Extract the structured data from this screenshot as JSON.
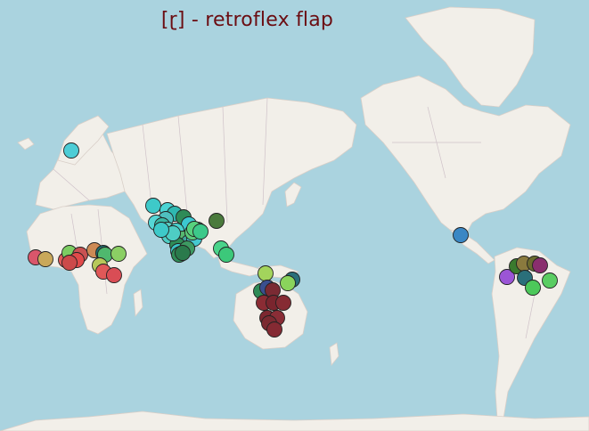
{
  "map": {
    "title": "[ɽ] - retroflex flap",
    "land_color": "#f2efe9",
    "water_color": "#aad3df",
    "marker_stroke": "#222222",
    "markers": [
      {
        "region": "scandinavia",
        "color": "#4ecdd6"
      },
      {
        "region": "west-africa",
        "color": "#d9566b"
      },
      {
        "region": "west-africa",
        "color": "#c9a85a"
      },
      {
        "region": "west-africa",
        "color": "#e05a5a"
      },
      {
        "region": "west-africa",
        "color": "#d94848"
      },
      {
        "region": "west-africa",
        "color": "#7ccc62"
      },
      {
        "region": "west-africa",
        "color": "#c95252"
      },
      {
        "region": "west-africa",
        "color": "#e04a4a"
      },
      {
        "region": "west-africa",
        "color": "#cc4a4a"
      },
      {
        "region": "west-africa",
        "color": "#cd8a55"
      },
      {
        "region": "west-africa",
        "color": "#1f6e6e"
      },
      {
        "region": "west-africa",
        "color": "#4fb86e"
      },
      {
        "region": "west-africa",
        "color": "#b8c85a"
      },
      {
        "region": "west-africa",
        "color": "#e05858"
      },
      {
        "region": "west-africa",
        "color": "#d94d55"
      },
      {
        "region": "west-africa",
        "color": "#8bcf64"
      },
      {
        "region": "south-asia",
        "color": "#3ec9c9"
      },
      {
        "region": "south-asia",
        "color": "#4ad4d4"
      },
      {
        "region": "south-asia",
        "color": "#2fb8b0"
      },
      {
        "region": "south-asia",
        "color": "#4fbfbf"
      },
      {
        "region": "south-asia",
        "color": "#55d6d6"
      },
      {
        "region": "south-asia",
        "color": "#3bb7a3"
      },
      {
        "region": "south-asia",
        "color": "#5bd3c7"
      },
      {
        "region": "south-asia",
        "color": "#2e8b57"
      },
      {
        "region": "south-asia",
        "color": "#3cc8d0"
      },
      {
        "region": "south-asia",
        "color": "#48d1cc"
      },
      {
        "region": "south-asia",
        "color": "#35a36a"
      },
      {
        "region": "south-asia",
        "color": "#4ecdc4"
      },
      {
        "region": "south-asia",
        "color": "#56b870"
      },
      {
        "region": "south-asia",
        "color": "#3fa9a0"
      },
      {
        "region": "south-asia",
        "color": "#2e8b57"
      },
      {
        "region": "south-asia",
        "color": "#3bc4c4"
      },
      {
        "region": "south-asia",
        "color": "#55d0a0"
      },
      {
        "region": "south-asia",
        "color": "#47b883"
      },
      {
        "region": "south-asia",
        "color": "#2e7d4f"
      },
      {
        "region": "south-asia",
        "color": "#45c8d0"
      },
      {
        "region": "south-asia",
        "color": "#3d9a62"
      },
      {
        "region": "south-asia",
        "color": "#5cc97a"
      },
      {
        "region": "south-asia",
        "color": "#2e8b57"
      },
      {
        "region": "south-asia",
        "color": "#2a7a4c"
      },
      {
        "region": "south-asia",
        "color": "#4ecdc4"
      },
      {
        "region": "south-asia",
        "color": "#3ec9c9"
      },
      {
        "region": "south-asia",
        "color": "#4a7a3c"
      },
      {
        "region": "south-asia",
        "color": "#57d17d"
      },
      {
        "region": "south-asia",
        "color": "#3dc98a"
      },
      {
        "region": "southeast-asia",
        "color": "#4ad38a"
      },
      {
        "region": "southeast-asia",
        "color": "#3cc87a"
      },
      {
        "region": "australia-new-guinea",
        "color": "#a3d45c"
      },
      {
        "region": "australia-new-guinea",
        "color": "#2a6f7a"
      },
      {
        "region": "australia-new-guinea",
        "color": "#8ad45c"
      },
      {
        "region": "australia-new-guinea",
        "color": "#2e8b57"
      },
      {
        "region": "australia-new-guinea",
        "color": "#3a4f8f"
      },
      {
        "region": "australia-new-guinea",
        "color": "#7a2a33"
      },
      {
        "region": "australia-new-guinea",
        "color": "#8b2c34"
      },
      {
        "region": "australia-new-guinea",
        "color": "#7a252e"
      },
      {
        "region": "australia-new-guinea",
        "color": "#862b33"
      },
      {
        "region": "australia-new-guinea",
        "color": "#7d2730"
      },
      {
        "region": "australia-new-guinea",
        "color": "#8a2d36"
      },
      {
        "region": "australia-new-guinea",
        "color": "#7b2a31"
      },
      {
        "region": "australia-new-guinea",
        "color": "#852a33"
      },
      {
        "region": "mexico",
        "color": "#3a87c4"
      },
      {
        "region": "south-america",
        "color": "#9b55d6"
      },
      {
        "region": "south-america",
        "color": "#3a7a2e"
      },
      {
        "region": "south-america",
        "color": "#8a7a3e"
      },
      {
        "region": "south-america",
        "color": "#6b6b2e"
      },
      {
        "region": "south-america",
        "color": "#8a2e6e"
      },
      {
        "region": "south-america",
        "color": "#2a6f7a"
      },
      {
        "region": "south-america",
        "color": "#4cc85a"
      },
      {
        "region": "south-america",
        "color": "#5acd62"
      }
    ]
  }
}
